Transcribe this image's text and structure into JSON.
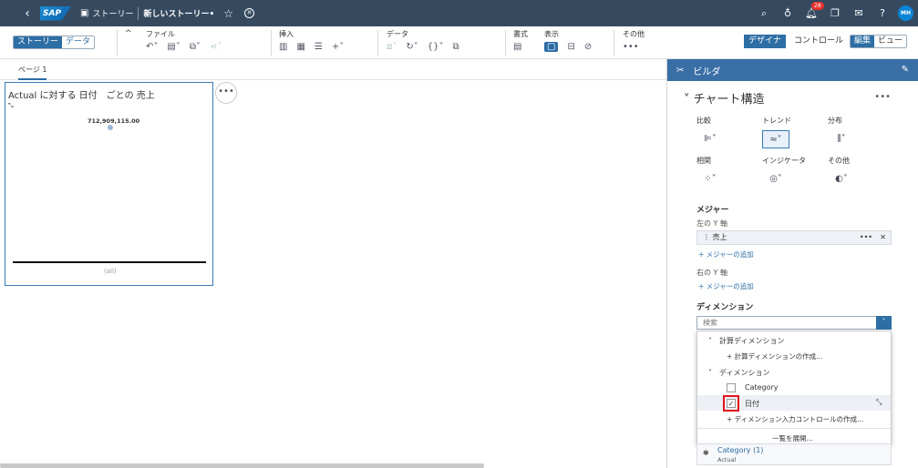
{
  "shell": {
    "crumb": "ストーリー",
    "title": "新しいストーリー•",
    "notification_count": "28",
    "avatar_initials": "MH"
  },
  "toolbar": {
    "mode_story": "ストーリー",
    "mode_data": "データ",
    "group_file": "ファイル",
    "group_insert": "挿入",
    "group_data": "データ",
    "group_format": "書式",
    "group_display": "表示",
    "group_other": "その他",
    "designer": "デザイナ",
    "control": "コントロール",
    "edit": "編集",
    "view": "ビュー"
  },
  "page": {
    "tab_label": "ページ 1"
  },
  "chart": {
    "title": "Actual に対する 日付　ごとの 売上",
    "data_label": "712,909,115.00",
    "axis_label": "(all)"
  },
  "chart_data": {
    "type": "scatter",
    "title": "Actual に対する 日付　ごとの 売上",
    "categories": [
      "(all)"
    ],
    "values": [
      712909115.0
    ]
  },
  "panel": {
    "header": "ビルダ",
    "section": "チャート構造",
    "categories": {
      "comparison": "比較",
      "trend": "トレンド",
      "distribution": "分布",
      "correlation": "相関",
      "indicator": "インジケータ",
      "other": "その他"
    },
    "measures_header": "メジャー",
    "left_y_axis": "左の Y 軸",
    "measure_item": "売上",
    "add_measure": "+ メジャーの追加",
    "right_y_axis": "右の Y 軸",
    "add_measure_right": "+ メジャーの追加",
    "dimensions_header": "ディメンション",
    "search_placeholder": "検索",
    "dropdown": {
      "calc_group": "計算ディメンション",
      "calc_create": "+ 計算ディメンションの作成...",
      "dim_group": "ディメンション",
      "item_category": "Category",
      "item_date": "日付",
      "input_control": "+ ディメンション入力コントロールの作成...",
      "expand_list": "一覧を展開..."
    },
    "bottom_card": {
      "title": "Category (1)",
      "sub": "Actual"
    }
  }
}
